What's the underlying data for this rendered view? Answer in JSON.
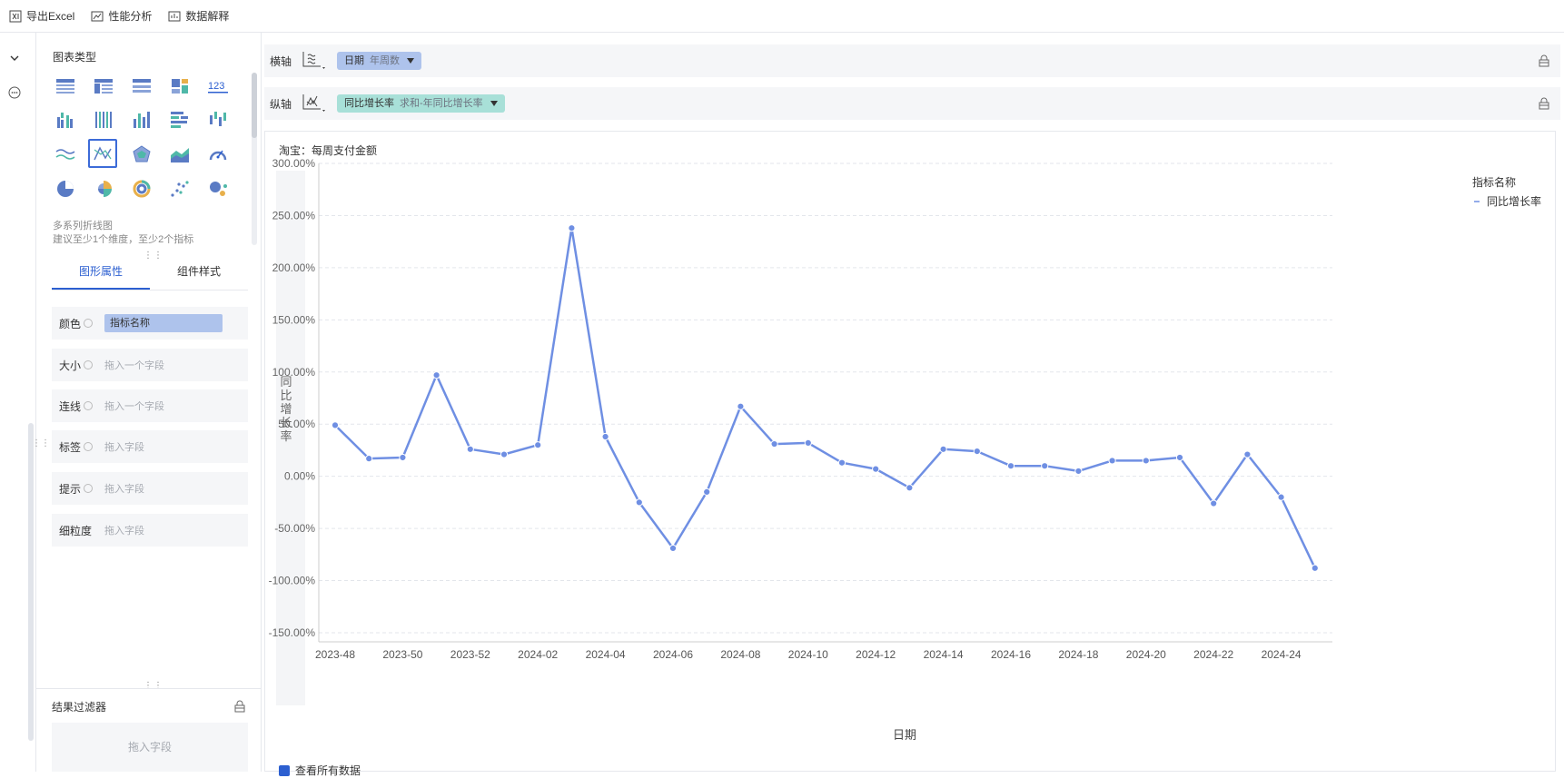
{
  "toolbar": {
    "items": [
      {
        "label": "导出Excel",
        "icon": "excel-icon"
      },
      {
        "label": "性能分析",
        "icon": "performance-icon"
      },
      {
        "label": "数据解释",
        "icon": "explain-icon"
      }
    ]
  },
  "panel": {
    "chart_type_title": "图表类型",
    "chart_desc_line1": "多系列折线图",
    "chart_desc_line2": "建议至少1个维度，至少2个指标",
    "tabs": [
      "图形属性",
      "组件样式"
    ],
    "attributes": [
      {
        "label": "颜色",
        "value": "指标名称",
        "filled": true,
        "gear": true
      },
      {
        "label": "大小",
        "value": "拖入一个字段",
        "filled": false,
        "gear": true
      },
      {
        "label": "连线",
        "value": "拖入一个字段",
        "filled": false,
        "gear": true
      },
      {
        "label": "标签",
        "value": "拖入字段",
        "filled": false,
        "gear": true
      },
      {
        "label": "提示",
        "value": "拖入字段",
        "filled": false,
        "gear": true
      },
      {
        "label": "细粒度",
        "value": "拖入字段",
        "filled": false,
        "gear": false
      }
    ],
    "filter_title": "结果过滤器",
    "filter_placeholder": "拖入字段"
  },
  "x_axis": {
    "label": "横轴",
    "field": "日期",
    "sub": "年周数",
    "color": "#aec3ec"
  },
  "y_axis": {
    "label": "纵轴",
    "field": "同比增长率",
    "sub": "求和-年同比增长率",
    "color": "#a8e0d8"
  },
  "chart": {
    "subtitle": "淘宝：每周支付金额",
    "legend_title": "指标名称",
    "legend_item": "同比增长率",
    "show_all": "查看所有数据"
  },
  "chart_data": {
    "type": "line",
    "xlabel": "日期",
    "ylabel": "同比增长率",
    "ylim": [
      -150,
      300
    ],
    "y_ticks": [
      "300.00%",
      "250.00%",
      "200.00%",
      "150.00%",
      "100.00%",
      "50.00%",
      "0.00%",
      "-50.00%",
      "-100.00%",
      "-150.00%"
    ],
    "x_ticks": [
      "2023-48",
      "2023-50",
      "2023-52",
      "2024-02",
      "2024-04",
      "2024-06",
      "2024-08",
      "2024-10",
      "2024-12",
      "2024-14",
      "2024-16",
      "2024-18",
      "2024-20",
      "2024-22",
      "2024-24"
    ],
    "x": [
      "2023-48",
      "2023-49",
      "2023-50",
      "2023-51",
      "2023-52",
      "2024-01",
      "2024-02",
      "2024-03",
      "2024-04",
      "2024-05",
      "2024-06",
      "2024-07",
      "2024-08",
      "2024-09",
      "2024-10",
      "2024-11",
      "2024-12",
      "2024-13",
      "2024-14",
      "2024-15",
      "2024-16",
      "2024-17",
      "2024-18",
      "2024-19",
      "2024-20",
      "2024-21",
      "2024-22",
      "2024-23",
      "2024-24",
      "2024-25"
    ],
    "series": [
      {
        "name": "同比增长率",
        "color": "#6f8fe3",
        "values": [
          49,
          17,
          18,
          97,
          26,
          21,
          30,
          238,
          38,
          -25,
          -69,
          -15,
          67,
          31,
          32,
          13,
          7,
          -11,
          26,
          24,
          10,
          10,
          5,
          15,
          15,
          18,
          -26,
          21,
          -20,
          -88
        ]
      }
    ],
    "grid": true,
    "legend_position": "top-right"
  }
}
